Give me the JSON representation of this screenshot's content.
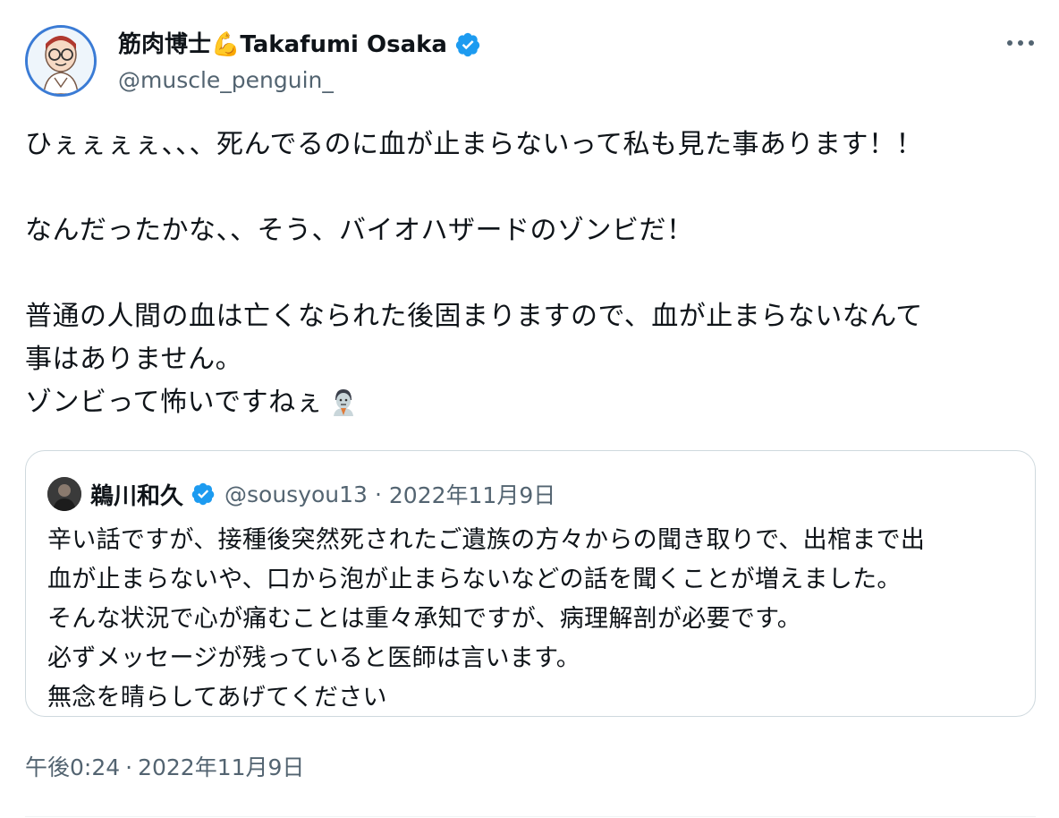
{
  "author": {
    "display_name": "筋肉博士💪Takafumi Osaka",
    "handle": "@muscle_penguin_",
    "verified": true
  },
  "tweet": {
    "lines": [
      "ひぇぇぇぇ、、、死んでるのに血が止まらないって私も見た事あります！！",
      "",
      "なんだったかな、、そう、バイオハザードのゾンビだ！",
      "",
      "普通の人間の血は亡くなられた後固まりますので、血が止まらないなんて",
      "事はありません。",
      "ゾンビって怖いですねぇ"
    ],
    "trailing_emoji": "zombie-emoji",
    "timestamp_time": "午後0:24",
    "timestamp_sep": "·",
    "timestamp_date": "2022年11月9日"
  },
  "quoted_tweet": {
    "display_name": "鵜川和久",
    "handle": "@sousyou13",
    "sep": "·",
    "date": "2022年11月9日",
    "verified": true,
    "lines": [
      "辛い話ですが、接種後突然死されたご遺族の方々からの聞き取りで、出棺まで出",
      "血が止まらないや、口から泡が止まらないなどの話を聞くことが増えました。",
      "そんな状況で心が痛むことは重々承知ですが、病理解剖が必要です。",
      "必ずメッセージが残っていると医師は言います。",
      "無念を晴らしてあげてください"
    ]
  },
  "icons": {
    "verified": "verified-badge-icon",
    "more": "more-options-icon"
  },
  "colors": {
    "text": "#0f1419",
    "secondary": "#536471",
    "verified_blue": "#1d9bf0",
    "border": "#cfd9de"
  }
}
